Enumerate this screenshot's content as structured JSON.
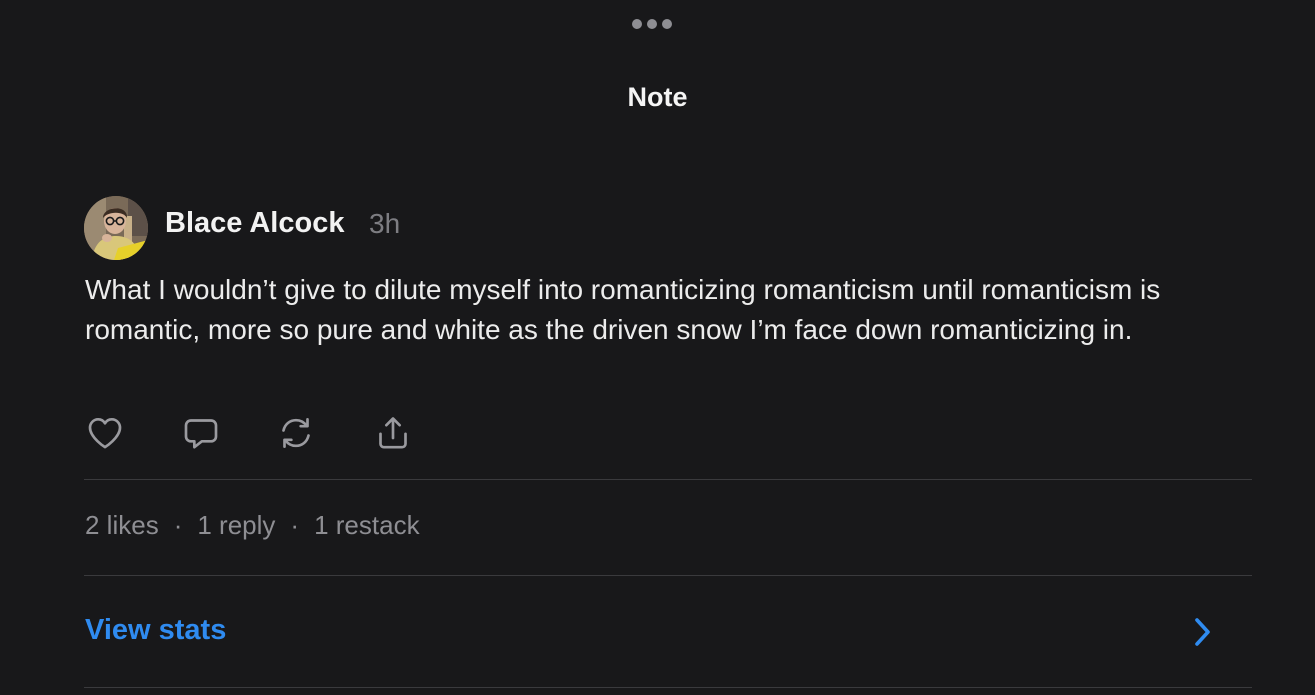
{
  "header": {
    "title": "Note",
    "more_icon": "more-horizontal-icon"
  },
  "note": {
    "author": "Blace Alcock",
    "timestamp": "3h",
    "body": "What I wouldn’t give to dilute myself into romanticizing romanticism until romanticism is romantic, more so pure and white as the driven snow I’m face down romanticizing in.",
    "actions": [
      {
        "name": "like",
        "icon": "heart-icon"
      },
      {
        "name": "reply",
        "icon": "comment-icon"
      },
      {
        "name": "restack",
        "icon": "restack-icon"
      },
      {
        "name": "share",
        "icon": "share-icon"
      }
    ]
  },
  "stats": {
    "likes": "2 likes",
    "replies": "1 reply",
    "restacks": "1 restack",
    "separator": "·"
  },
  "view_stats": {
    "label": "View stats",
    "icon": "chevron-right-icon"
  },
  "colors": {
    "background": "#18181a",
    "accent": "#2f8bf0",
    "muted_text": "#8e8e93",
    "divider": "#3a3a3d"
  }
}
